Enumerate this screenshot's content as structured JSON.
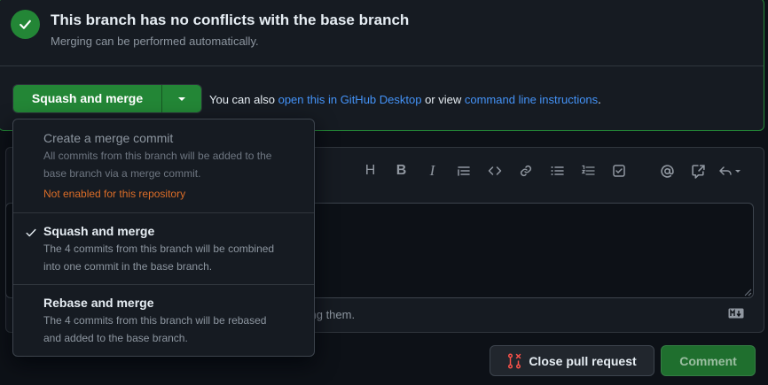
{
  "merge_status": {
    "title": "This branch has no conflicts with the base branch",
    "subtitle": "Merging can be performed automatically."
  },
  "merge_button": {
    "label": "Squash and merge"
  },
  "alternatives": {
    "prefix": "You can also ",
    "desktop_link": "open this in GitHub Desktop",
    "middle": " or view ",
    "cli_link": "command line instructions",
    "suffix": "."
  },
  "merge_menu": {
    "items": [
      {
        "title": "Create a merge commit",
        "description_line1": "All commits from this branch will be added to the",
        "description_line2": "base branch via a merge commit.",
        "warning": "Not enabled for this repository",
        "selected": false,
        "disabled": true
      },
      {
        "title": "Squash and merge",
        "description_line1": "The 4 commits from this branch will be combined",
        "description_line2": "into one commit in the base branch.",
        "selected": true,
        "disabled": false
      },
      {
        "title": "Rebase and merge",
        "description_line1": "The 4 commits from this branch will be rebased",
        "description_line2": "and added to the base branch.",
        "selected": false,
        "disabled": false
      }
    ]
  },
  "editor": {
    "toolbar_icons": [
      "heading-icon",
      "bold-icon",
      "italic-icon",
      "quote-icon",
      "code-icon",
      "link-icon",
      "unordered-list-icon",
      "ordered-list-icon",
      "task-list-icon",
      "mention-icon",
      "cross-reference-icon",
      "undo-dropdown-icon"
    ],
    "toolbar_heading_glyph": "H",
    "toolbar_bold_glyph": "B",
    "toolbar_italic_glyph": "I",
    "footer_text": "ting them."
  },
  "actions": {
    "close_pr_label": "Close pull request",
    "comment_label": "Comment"
  },
  "colors": {
    "accent_green": "#238636",
    "link_blue": "#4493f8",
    "warning_orange": "#db6d28",
    "close_icon_red": "#f85149"
  }
}
